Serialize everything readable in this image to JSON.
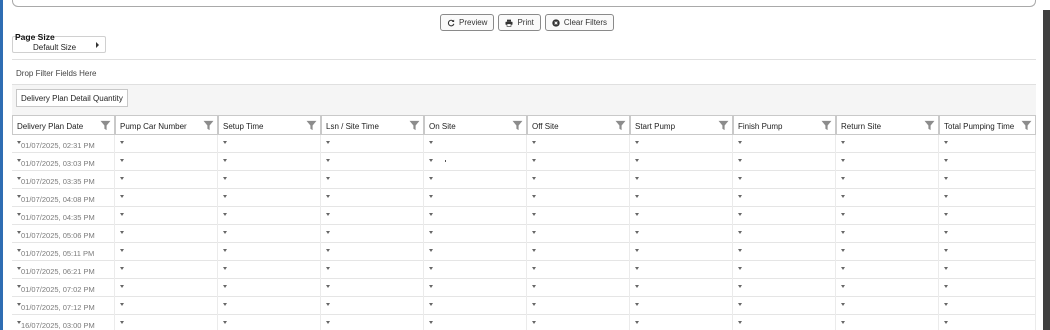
{
  "toolbar": {
    "preview_label": "Preview",
    "print_label": "Print",
    "clear_filters_label": "Clear Filters"
  },
  "page_size": {
    "label": "Page Size",
    "value": "Default Size"
  },
  "filter_drop_zone": "Drop Filter Fields Here",
  "data_field": "Delivery Plan Detail Quantity",
  "columns": [
    "Delivery Plan Date",
    "Pump Car Number",
    "Setup Time",
    "Lsn / Site Time",
    "On Site",
    "Off Site",
    "Start Pump",
    "Finish Pump",
    "Return Site",
    "Total Pumping Time"
  ],
  "rows": [
    "01/07/2025, 02:31 PM",
    "01/07/2025, 03:03 PM",
    "01/07/2025, 03:35 PM",
    "01/07/2025, 04:08 PM",
    "01/07/2025, 04:35 PM",
    "01/07/2025, 05:06 PM",
    "01/07/2025, 05:11 PM",
    "01/07/2025, 06:21 PM",
    "01/07/2025, 07:02 PM",
    "01/07/2025, 07:12 PM",
    "16/07/2025, 03:00 PM"
  ],
  "icons": {
    "preview": "refresh-icon",
    "print": "printer-icon",
    "clear": "close-circle-icon",
    "filter": "filter-icon"
  }
}
